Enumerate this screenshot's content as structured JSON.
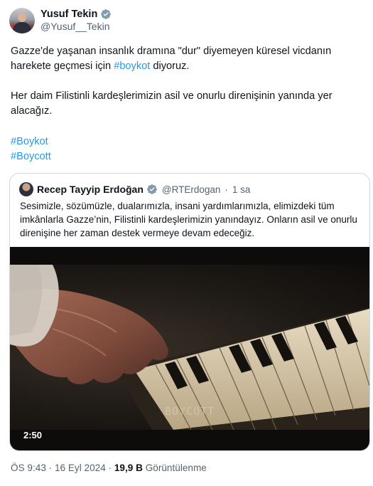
{
  "author": {
    "display_name": "Yusuf Tekin",
    "handle": "@Yusuf__Tekin"
  },
  "tweet": {
    "line1": "Gazze'de yaşanan insanlık dramına \"dur\" diyemeyen küresel vicdanın",
    "line2_prefix": "harekete geçmesi için ",
    "line2_hashtag": "#boykot",
    "line2_suffix": " diyoruz.",
    "line3": "Her daim Filistinli kardeşlerimizin asil ve onurlu direnişinin yanında yer",
    "line4": "alacağız.",
    "hashtag1": "#Boykot",
    "hashtag2": "#Boycott"
  },
  "quote": {
    "display_name": "Recep Tayyip Erdoğan",
    "handle": "@RTErdogan",
    "separator": "·",
    "time": "1 sa",
    "line1": "Sesimizle, sözümüzle, dualarımızla, insani yardımlarımızla, elimizdeki tüm",
    "line2": "imkânlarla Gazze’nin, Filistinli kardeşlerimizin yanındayız. Onların asil ve onurlu",
    "line3": "direnişine her zaman destek vermeye devam edeceğiz.",
    "video": {
      "duration": "2:50",
      "watermark": "BOYCOTT"
    }
  },
  "footer": {
    "time": "ÖS 9:43",
    "sep1": " · ",
    "date": "16 Eyl 2024",
    "sep2": " · ",
    "views_count": "19,9 B",
    "views_label": " Görüntülenme"
  },
  "colors": {
    "link": "#1d9bf0",
    "secondary_text": "#536471",
    "border": "#cfd9de"
  },
  "icons": {
    "verified": "verified-badge-icon"
  }
}
